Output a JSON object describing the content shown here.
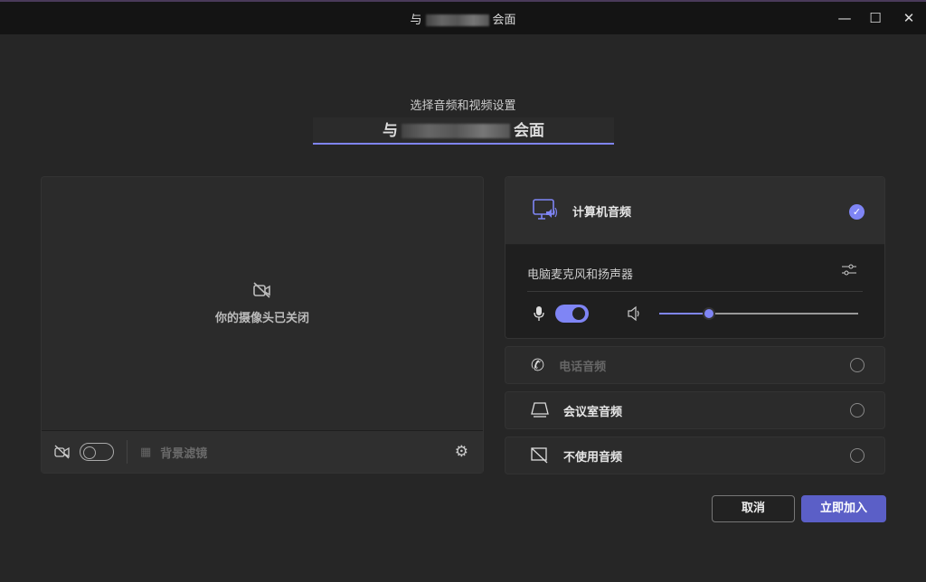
{
  "window": {
    "title_prefix": "与",
    "title_suffix": "会面",
    "minimize": "—",
    "maximize": "☐",
    "close": "✕"
  },
  "header": {
    "subtitle": "选择音频和视频设置",
    "meeting_prefix": "与",
    "meeting_suffix": "会面"
  },
  "video": {
    "camera_off_text": "你的摄像头已关闭",
    "background_filter": "背景滤镜"
  },
  "audio": {
    "computer": {
      "label": "计算机音频",
      "device": "电脑麦克风和扬声器",
      "mic_on": true,
      "volume_percent": 25
    },
    "phone": {
      "label": "电话音频"
    },
    "room": {
      "label": "会议室音频"
    },
    "none": {
      "label": "不使用音频"
    }
  },
  "buttons": {
    "cancel": "取消",
    "join": "立即加入"
  },
  "colors": {
    "accent": "#7f85f5",
    "join": "#5b5fc7"
  }
}
